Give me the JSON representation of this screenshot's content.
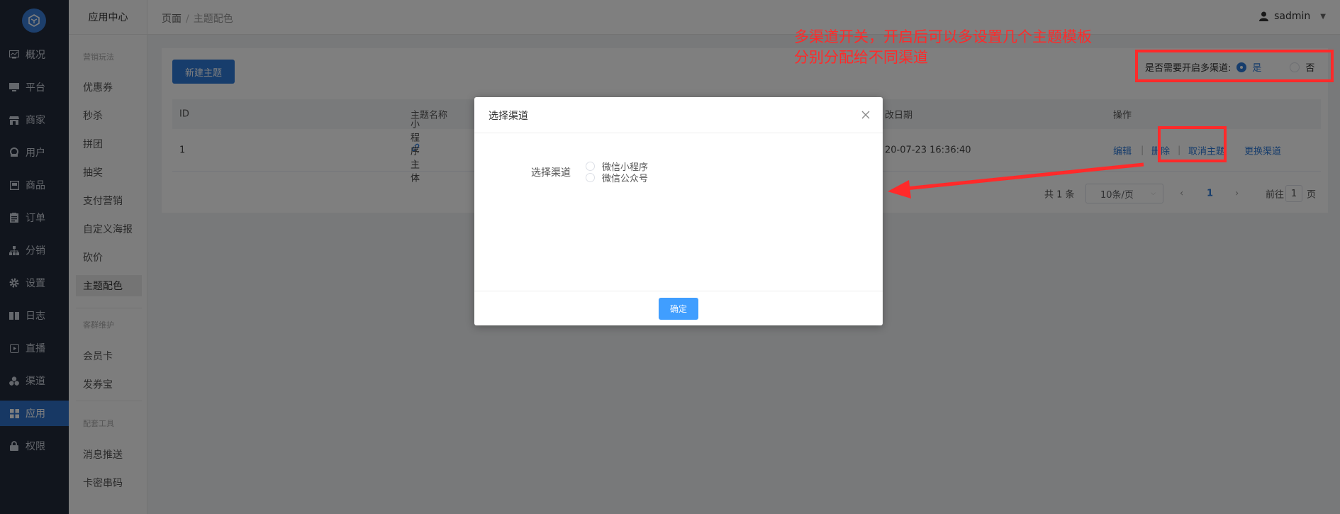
{
  "sidebar": {
    "items": [
      {
        "label": "概况",
        "icon": "dashboard-icon"
      },
      {
        "label": "平台",
        "icon": "monitor-icon"
      },
      {
        "label": "商家",
        "icon": "store-icon"
      },
      {
        "label": "用户",
        "icon": "user-icon"
      },
      {
        "label": "商品",
        "icon": "goods-icon"
      },
      {
        "label": "订单",
        "icon": "order-icon"
      },
      {
        "label": "分销",
        "icon": "sitemap-icon"
      },
      {
        "label": "设置",
        "icon": "gear-icon"
      },
      {
        "label": "日志",
        "icon": "book-icon"
      },
      {
        "label": "直播",
        "icon": "play-icon"
      },
      {
        "label": "渠道",
        "icon": "cubes-icon"
      },
      {
        "label": "应用",
        "icon": "grid-icon"
      },
      {
        "label": "权限",
        "icon": "lock-icon"
      }
    ],
    "active_index": 11
  },
  "subnav": {
    "title": "应用中心",
    "groups": [
      {
        "label": "营销玩法"
      },
      {
        "label": "客群维护"
      },
      {
        "label": "配套工具"
      }
    ],
    "items": [
      {
        "label": "优惠券"
      },
      {
        "label": "秒杀"
      },
      {
        "label": "拼团"
      },
      {
        "label": "抽奖"
      },
      {
        "label": "支付营销"
      },
      {
        "label": "自定义海报"
      },
      {
        "label": "砍价"
      },
      {
        "label": "主题配色"
      },
      {
        "label": "会员卡"
      },
      {
        "label": "发券宝"
      },
      {
        "label": "消息推送"
      },
      {
        "label": "卡密串码"
      }
    ]
  },
  "header": {
    "breadcrumb": [
      "页面",
      "主题配色"
    ],
    "breadcrumb_sep": "/",
    "username": "sadmin"
  },
  "toolbar": {
    "new_label": "新建主题"
  },
  "switch": {
    "label": "是否需要开启多渠道:",
    "yes": "是",
    "no": "否",
    "selected": "是"
  },
  "table": {
    "columns": [
      "ID",
      "主题名称",
      "改日期",
      "操作"
    ],
    "rows": [
      {
        "id": "1",
        "name": "小程序主体",
        "date": "20-07-23 16:36:40"
      }
    ],
    "actions": [
      "编辑",
      "删除",
      "取消主题",
      "更换渠道"
    ],
    "action_sep": "|"
  },
  "pager": {
    "total": "共 1 条",
    "page_size": "10条/页",
    "prev": "‹",
    "current": "1",
    "next": "›",
    "goto_label": "前往",
    "goto_value": "1",
    "goto_suffix": "页"
  },
  "modal": {
    "title": "选择渠道",
    "field_label": "选择渠道",
    "options": [
      "微信小程序",
      "微信公众号"
    ],
    "confirm": "确定"
  },
  "annotation": {
    "line1": "多渠道开关，开启后可以多设置几个主题模板",
    "line2": "分别分配给不同渠道",
    "color": "#ff2a2a"
  },
  "colors": {
    "sidebar_bg": "#232a3b",
    "active_nav": "#2f70c9",
    "primary": "#2f7bd9",
    "confirm_button": "#409eff"
  }
}
